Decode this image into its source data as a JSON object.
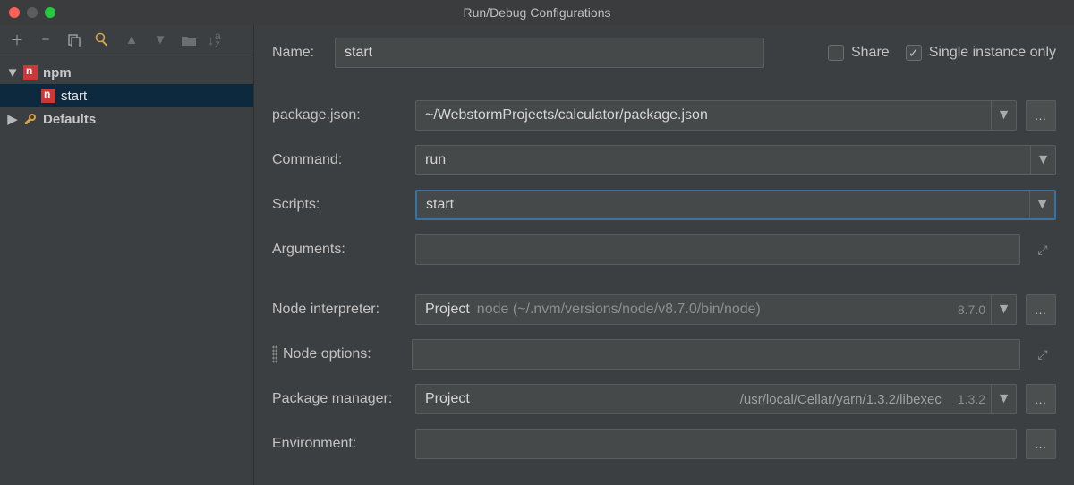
{
  "window": {
    "title": "Run/Debug Configurations"
  },
  "sidebar": {
    "nodes": [
      {
        "label": "npm"
      },
      {
        "label": "start"
      },
      {
        "label": "Defaults"
      }
    ]
  },
  "form": {
    "name_label": "Name:",
    "name_value": "start",
    "share_label": "Share",
    "single_label": "Single instance only",
    "package_json_label": "package.json:",
    "package_json_value": "~/WebstormProjects/calculator/package.json",
    "command_label": "Command:",
    "command_value": "run",
    "scripts_label": "Scripts:",
    "scripts_value": "start",
    "arguments_label": "Arguments:",
    "arguments_value": "",
    "interpreter_label": "Node interpreter:",
    "interpreter_prefix": "Project",
    "interpreter_detail": "node (~/.nvm/versions/node/v8.7.0/bin/node)",
    "interpreter_version": "8.7.0",
    "node_options_label": "Node options:",
    "node_options_value": "",
    "pkgmgr_label": "Package manager:",
    "pkgmgr_prefix": "Project",
    "pkgmgr_path": "/usr/local/Cellar/yarn/1.3.2/libexec",
    "pkgmgr_version": "1.3.2",
    "env_label": "Environment:",
    "env_value": ""
  }
}
